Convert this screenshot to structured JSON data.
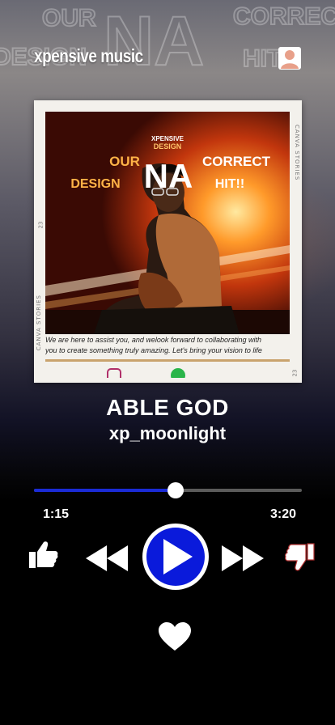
{
  "header": {
    "brand": "xpensive music",
    "background_text": [
      "OUR",
      "CORRECT",
      "DESIGN",
      "NA",
      "HIT!!"
    ]
  },
  "cover": {
    "logo_top": "XPENSIVE",
    "logo_bottom": "DESIGN",
    "headline_left_1": "OUR",
    "headline_left_2": "DESIGN",
    "headline_center": "NA",
    "headline_right_1": "CORRECT",
    "headline_right_2": "HIT!!",
    "blurb_line1": "We are here to assist you, and welook forward  to collaborating with",
    "blurb_line2": "you to create something truly amazing. Let's bring your vision to life",
    "side_text": "CANVA STORIES",
    "page_marker": "23"
  },
  "song": {
    "title": "ABLE GOD",
    "artist": "xp_moonlight"
  },
  "progress": {
    "elapsed": "1:15",
    "duration": "3:20",
    "fraction": 0.53
  },
  "colors": {
    "accent": "#1a2bd6",
    "play_circle": "#0a1adb",
    "background": "#000000"
  },
  "controls": {
    "icons": [
      "thumbs-up-icon",
      "rewind-icon",
      "play-icon",
      "fast-forward-icon",
      "thumbs-down-icon",
      "heart-icon"
    ]
  }
}
